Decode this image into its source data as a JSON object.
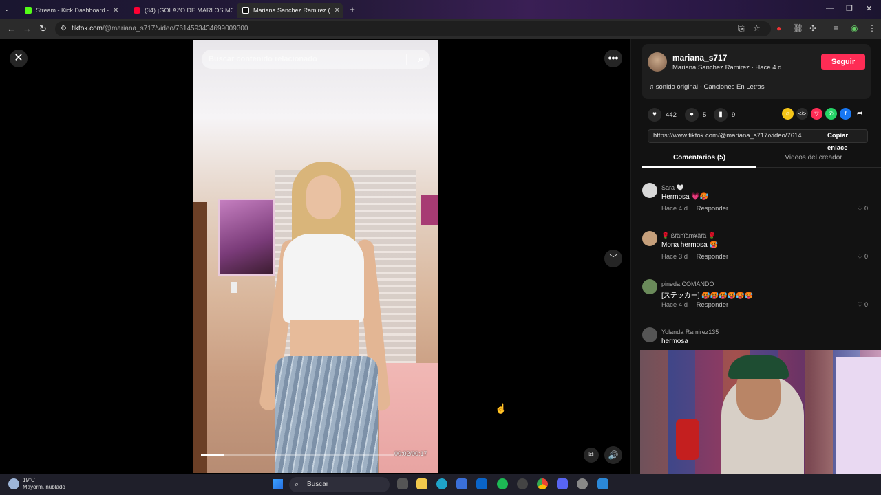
{
  "browser": {
    "tabs": [
      {
        "title": "Stream - Kick Dashboard -",
        "favicon_color": "#53fc18",
        "active": false
      },
      {
        "title": "(34) ¡GOLAZO DE MARLOS MO",
        "favicon_color": "#ff0033",
        "active": false
      },
      {
        "title": "Mariana Sanchez Ramirez (",
        "favicon_color": "#ffffff",
        "active": true
      }
    ],
    "new_tab_label": "+",
    "url_host": "tiktok.com",
    "url_path": "/@mariana_s717/video/7614593434699009300"
  },
  "video": {
    "search_placeholder": "Buscar contenido relacionado",
    "progress": 0.12,
    "timecode": "00:02/00:17"
  },
  "creator": {
    "username": "mariana_s717",
    "info": "Mariana Sanchez Ramirez · Hace 4 d",
    "follow_label": "Seguir",
    "music": "sonido original - Canciones En Letras"
  },
  "stats": {
    "likes": "442",
    "comments": "5",
    "saves": "9"
  },
  "share": {
    "link": "https://www.tiktok.com/@mariana_s717/video/7614...",
    "copy_label": "Copiar enlace"
  },
  "tabs": {
    "comments": "Comentarios (5)",
    "creator_videos": "Videos del creador"
  },
  "comments": [
    {
      "user": "Sara 🤍",
      "text": "Hermosa 💗🥵",
      "time": "Hace 4 d",
      "reply": "Responder",
      "likes": "0"
    },
    {
      "user": "🌹 ßřǎhĭǎm¥ǎřǎ 🌹",
      "text": "Mona hermosa 🥵",
      "time": "Hace 3 d",
      "reply": "Responder",
      "likes": "0"
    },
    {
      "user": "pineda,COMANDO",
      "text": "[ステッカー] 🥵🥵🥵🥵🥵🥵",
      "time": "Hace 4 d",
      "reply": "Responder",
      "likes": "0"
    },
    {
      "user": "Yolanda Ramirez135",
      "text": "hermosa",
      "time": "",
      "reply": "",
      "likes": ""
    }
  ],
  "taskbar": {
    "temp": "19°C",
    "weather": "Mayorm. nublado",
    "search_label": "Buscar"
  },
  "colors": {
    "accent": "#fe2c55",
    "panel_bg": "#121212"
  }
}
